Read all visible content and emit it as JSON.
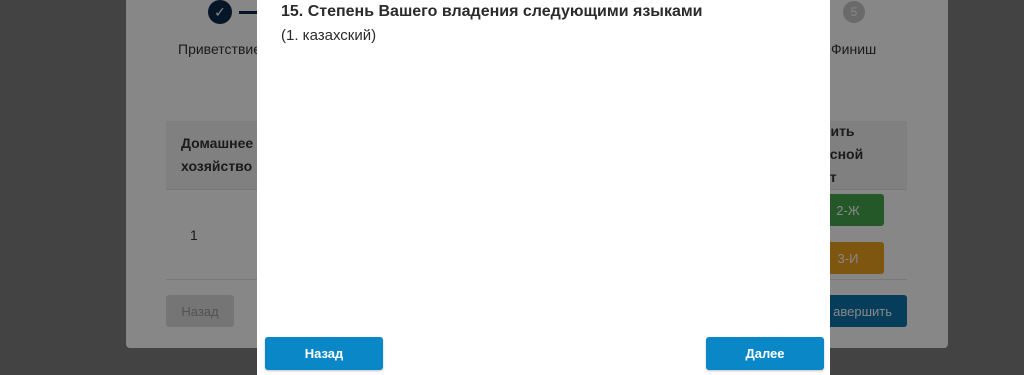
{
  "background": {
    "stepper": {
      "completed_icon": "check-icon",
      "step_welcome_label": "Приветствие",
      "step_5_number": "5",
      "step_finish_label": "Финиш"
    },
    "table": {
      "header_left": "Домашнее хозяйство",
      "header_right": "нить\nасной\nст",
      "row_number": "1",
      "button_2": "2-Ж",
      "button_3": "3-И"
    },
    "footer": {
      "back_label": "Назад",
      "finish_label": "авершить"
    }
  },
  "modal": {
    "title": "15. Степень Вашего владения следующими языками",
    "subtitle": "(1. казахский)",
    "back_label": "Назад",
    "next_label": "Далее"
  },
  "colors": {
    "primary": "#0a87c7",
    "dark_primary": "#0b73ad",
    "stepper_active": "#0d2a4e",
    "green": "#46a64e",
    "orange": "#f0a21e"
  }
}
